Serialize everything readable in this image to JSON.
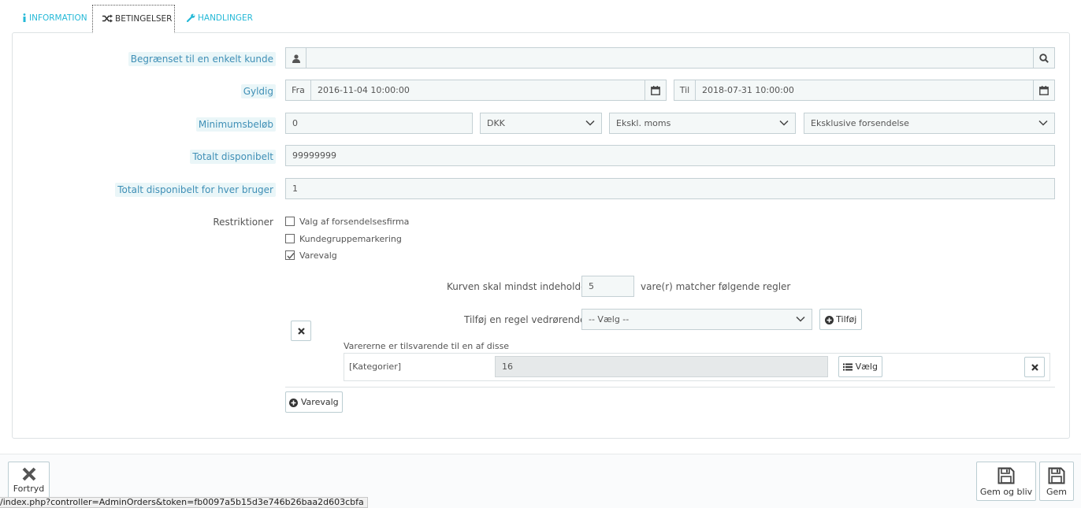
{
  "tabs": {
    "information": "INFORMATION",
    "conditions": "BETINGELSER",
    "actions": "HANDLINGER"
  },
  "form": {
    "customer_label": "Begrænset til en enkelt kunde",
    "customer_value": "",
    "valid_label": "Gyldig",
    "from_label": "Fra",
    "from_value": "2016-11-04 10:00:00",
    "to_label": "Til",
    "to_value": "2018-07-31 10:00:00",
    "min_amount_label": "Minimumsbeløb",
    "min_amount_value": "0",
    "currency": "DKK",
    "tax": "Ekskl. moms",
    "shipping": "Eksklusive forsendelse",
    "total_label": "Totalt disponibelt",
    "total_value": "99999999",
    "per_user_label": "Totalt disponibelt for hver bruger",
    "per_user_value": "1",
    "restrictions_label": "Restriktioner",
    "restrictions": [
      {
        "label": "Valg af forsendelsesfirma",
        "checked": false
      },
      {
        "label": "Kundegruppemarkering",
        "checked": false
      },
      {
        "label": "Varevalg",
        "checked": true
      }
    ]
  },
  "product_rules": {
    "cart_min_label": "Kurven skal mindst indeholde",
    "cart_min_value": "5",
    "cart_min_suffix": "vare(r) matcher følgende regler",
    "add_rule_label": "Tilføj en regel vedrørende",
    "rule_select": "-- Vælg --",
    "add_button": "Tilføj",
    "group_caption": "Varererne er tilsvarende til en af disse",
    "rule_type": "[Kategorier]",
    "rule_value": "16",
    "choose_button": "Vælg",
    "product_selection_button": "Varevalg"
  },
  "footer": {
    "cancel": "Fortryd",
    "save_and_stay": "Gem og bliv",
    "save": "Gem"
  },
  "statusbar": {
    "url": "/index.php?controller=AdminOrders&token=fb0097a5b15d3e746b26baa2d603cbfa"
  },
  "colors": {
    "accent": "#25b9d7",
    "label_blue": "#3f8fb6",
    "input_bg": "#f4f8f8"
  }
}
